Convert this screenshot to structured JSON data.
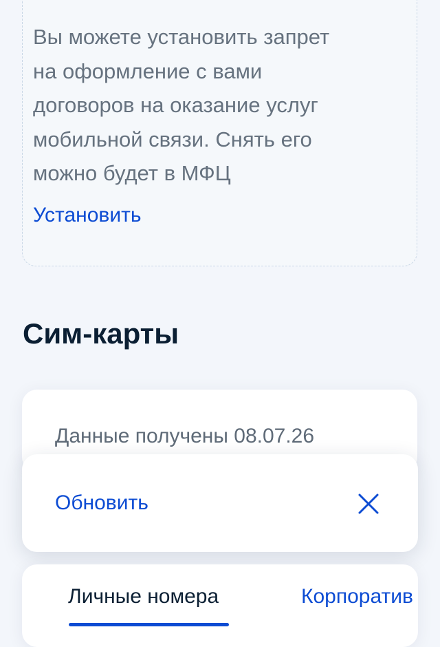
{
  "ban_card": {
    "text": "Вы можете установить запрет на оформление с вами договоров на оказание услуг мобильной связи. Снять его можно будет в МФЦ",
    "link_label": "Установить"
  },
  "sim_section": {
    "title": "Сим-карты",
    "data_received": "Данные получены 08.07.26"
  },
  "toast": {
    "action_label": "Обновить",
    "close_icon": "close-icon"
  },
  "tabs": [
    {
      "label": "Личные номера",
      "selected": true
    },
    {
      "label": "Корпоратив",
      "selected": false
    }
  ],
  "colors": {
    "accent": "#0d4cd3",
    "text_primary": "#0b1f33",
    "text_secondary": "#66727f",
    "background": "#f3f6fb"
  }
}
